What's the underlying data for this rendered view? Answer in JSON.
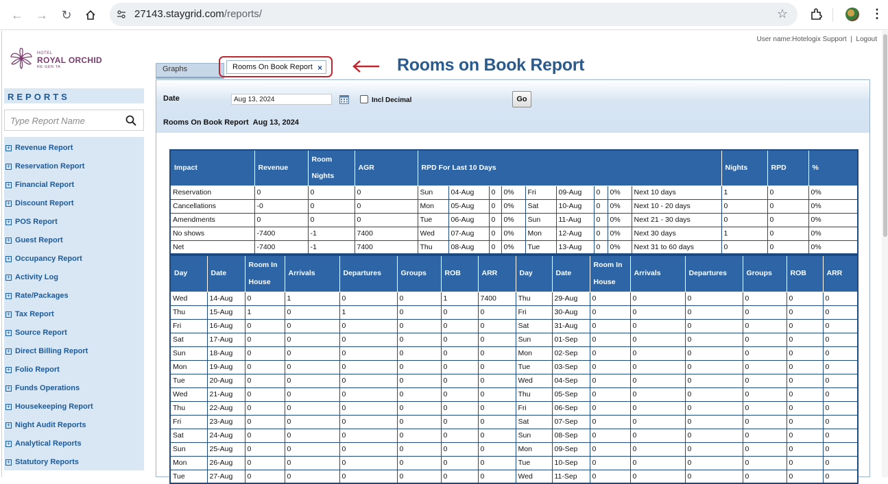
{
  "browser": {
    "url_host": "27143.staygrid.com",
    "url_path": "/reports/"
  },
  "user": {
    "label": "User name:Hotelogix Support",
    "separator": "|",
    "logout": "Logout"
  },
  "logo": {
    "small": "HOTEL",
    "main": "ROYAL ORCHID",
    "sub": "RE·GEN·TA"
  },
  "sidebar": {
    "title": "REPORTS",
    "search_placeholder": "Type Report Name",
    "items": [
      {
        "label": "Revenue Report"
      },
      {
        "label": "Reservation Report"
      },
      {
        "label": "Financial Report"
      },
      {
        "label": "Discount Report"
      },
      {
        "label": "POS Report"
      },
      {
        "label": "Guest Report"
      },
      {
        "label": "Occupancy Report"
      },
      {
        "label": "Activity Log"
      },
      {
        "label": "Rate/Packages"
      },
      {
        "label": "Tax Report"
      },
      {
        "label": "Source Report"
      },
      {
        "label": "Direct Billing Report"
      },
      {
        "label": "Folio Report"
      },
      {
        "label": "Funds Operations"
      },
      {
        "label": "Housekeeping Report"
      },
      {
        "label": "Night Audit Reports"
      },
      {
        "label": "Analytical Reports"
      },
      {
        "label": "Statutory Reports"
      }
    ]
  },
  "tabs": {
    "graphs": "Graphs",
    "active": "Rooms On Book Report",
    "close": "×"
  },
  "annotation": {
    "text": "Rooms on Book Report",
    "color": "#c0262f"
  },
  "filters": {
    "date_label": "Date",
    "date_value": "Aug 13, 2024",
    "incl_decimal_label": "Incl Decimal",
    "incl_decimal_checked": false,
    "go_label": "Go"
  },
  "report": {
    "title": "Rooms On Book Report",
    "date": "Aug 13, 2024"
  },
  "impact_table": {
    "headers": {
      "impact": "Impact",
      "revenue": "Revenue",
      "room_nights": "Room Nights",
      "agr": "AGR",
      "rpd_last_10": "RPD For Last 10 Days",
      "nights": "Nights",
      "rpd": "RPD",
      "pct": "%"
    },
    "rows": [
      {
        "impact": "Reservation",
        "revenue": "0",
        "room_nights": "0",
        "agr": "0",
        "d1": "Sun",
        "dt1": "04-Aug",
        "v1": "0",
        "p1": "0%",
        "d2": "Fri",
        "dt2": "09-Aug",
        "v2": "0",
        "p2": "0%",
        "range": "Next 10 days",
        "nights": "1",
        "rpd": "0",
        "pct": "0%"
      },
      {
        "impact": "Cancellations",
        "revenue": "-0",
        "room_nights": "0",
        "agr": "0",
        "d1": "Mon",
        "dt1": "05-Aug",
        "v1": "0",
        "p1": "0%",
        "d2": "Sat",
        "dt2": "10-Aug",
        "v2": "0",
        "p2": "0%",
        "range": "Next 10 - 20 days",
        "nights": "0",
        "rpd": "0",
        "pct": "0%"
      },
      {
        "impact": "Amendments",
        "revenue": "0",
        "room_nights": "0",
        "agr": "0",
        "d1": "Tue",
        "dt1": "06-Aug",
        "v1": "0",
        "p1": "0%",
        "d2": "Sun",
        "dt2": "11-Aug",
        "v2": "0",
        "p2": "0%",
        "range": "Next 21 - 30 days",
        "nights": "0",
        "rpd": "0",
        "pct": "0%"
      },
      {
        "impact": "No shows",
        "revenue": "-7400",
        "room_nights": "-1",
        "agr": "7400",
        "d1": "Wed",
        "dt1": "07-Aug",
        "v1": "0",
        "p1": "0%",
        "d2": "Mon",
        "dt2": "12-Aug",
        "v2": "0",
        "p2": "0%",
        "range": "Next 30 days",
        "nights": "1",
        "rpd": "0",
        "pct": "0%"
      },
      {
        "impact": "Net",
        "revenue": "-7400",
        "room_nights": "-1",
        "agr": "7400",
        "d1": "Thu",
        "dt1": "08-Aug",
        "v1": "0",
        "p1": "0%",
        "d2": "Tue",
        "dt2": "13-Aug",
        "v2": "0",
        "p2": "0%",
        "range": "Next 31 to 60 days",
        "nights": "0",
        "rpd": "0",
        "pct": "0%"
      }
    ]
  },
  "daily_table": {
    "headers": {
      "day": "Day",
      "date": "Date",
      "room_in_house": "Room In House",
      "arrivals": "Arrivals",
      "departures": "Departures",
      "groups": "Groups",
      "rob": "ROB",
      "arr": "ARR"
    },
    "rows": [
      {
        "l": [
          "Wed",
          "14-Aug",
          "0",
          "1",
          "0",
          "0",
          "1",
          "7400"
        ],
        "r": [
          "Thu",
          "29-Aug",
          "0",
          "0",
          "0",
          "0",
          "0",
          "0"
        ]
      },
      {
        "l": [
          "Thu",
          "15-Aug",
          "1",
          "0",
          "1",
          "0",
          "0",
          "0"
        ],
        "r": [
          "Fri",
          "30-Aug",
          "0",
          "0",
          "0",
          "0",
          "0",
          "0"
        ]
      },
      {
        "l": [
          "Fri",
          "16-Aug",
          "0",
          "0",
          "0",
          "0",
          "0",
          "0"
        ],
        "r": [
          "Sat",
          "31-Aug",
          "0",
          "0",
          "0",
          "0",
          "0",
          "0"
        ]
      },
      {
        "l": [
          "Sat",
          "17-Aug",
          "0",
          "0",
          "0",
          "0",
          "0",
          "0"
        ],
        "r": [
          "Sun",
          "01-Sep",
          "0",
          "0",
          "0",
          "0",
          "0",
          "0"
        ]
      },
      {
        "l": [
          "Sun",
          "18-Aug",
          "0",
          "0",
          "0",
          "0",
          "0",
          "0"
        ],
        "r": [
          "Mon",
          "02-Sep",
          "0",
          "0",
          "0",
          "0",
          "0",
          "0"
        ]
      },
      {
        "l": [
          "Mon",
          "19-Aug",
          "0",
          "0",
          "0",
          "0",
          "0",
          "0"
        ],
        "r": [
          "Tue",
          "03-Sep",
          "0",
          "0",
          "0",
          "0",
          "0",
          "0"
        ]
      },
      {
        "l": [
          "Tue",
          "20-Aug",
          "0",
          "0",
          "0",
          "0",
          "0",
          "0"
        ],
        "r": [
          "Wed",
          "04-Sep",
          "0",
          "0",
          "0",
          "0",
          "0",
          "0"
        ]
      },
      {
        "l": [
          "Wed",
          "21-Aug",
          "0",
          "0",
          "0",
          "0",
          "0",
          "0"
        ],
        "r": [
          "Thu",
          "05-Sep",
          "0",
          "0",
          "0",
          "0",
          "0",
          "0"
        ]
      },
      {
        "l": [
          "Thu",
          "22-Aug",
          "0",
          "0",
          "0",
          "0",
          "0",
          "0"
        ],
        "r": [
          "Fri",
          "06-Sep",
          "0",
          "0",
          "0",
          "0",
          "0",
          "0"
        ]
      },
      {
        "l": [
          "Fri",
          "23-Aug",
          "0",
          "0",
          "0",
          "0",
          "0",
          "0"
        ],
        "r": [
          "Sat",
          "07-Sep",
          "0",
          "0",
          "0",
          "0",
          "0",
          "0"
        ]
      },
      {
        "l": [
          "Sat",
          "24-Aug",
          "0",
          "0",
          "0",
          "0",
          "0",
          "0"
        ],
        "r": [
          "Sun",
          "08-Sep",
          "0",
          "0",
          "0",
          "0",
          "0",
          "0"
        ]
      },
      {
        "l": [
          "Sun",
          "25-Aug",
          "0",
          "0",
          "0",
          "0",
          "0",
          "0"
        ],
        "r": [
          "Mon",
          "09-Sep",
          "0",
          "0",
          "0",
          "0",
          "0",
          "0"
        ]
      },
      {
        "l": [
          "Mon",
          "26-Aug",
          "0",
          "0",
          "0",
          "0",
          "0",
          "0"
        ],
        "r": [
          "Tue",
          "10-Sep",
          "0",
          "0",
          "0",
          "0",
          "0",
          "0"
        ]
      },
      {
        "l": [
          "Tue",
          "27-Aug",
          "0",
          "0",
          "0",
          "0",
          "0",
          "0"
        ],
        "r": [
          "Wed",
          "11-Sep",
          "0",
          "0",
          "0",
          "0",
          "0",
          "0"
        ]
      }
    ]
  }
}
